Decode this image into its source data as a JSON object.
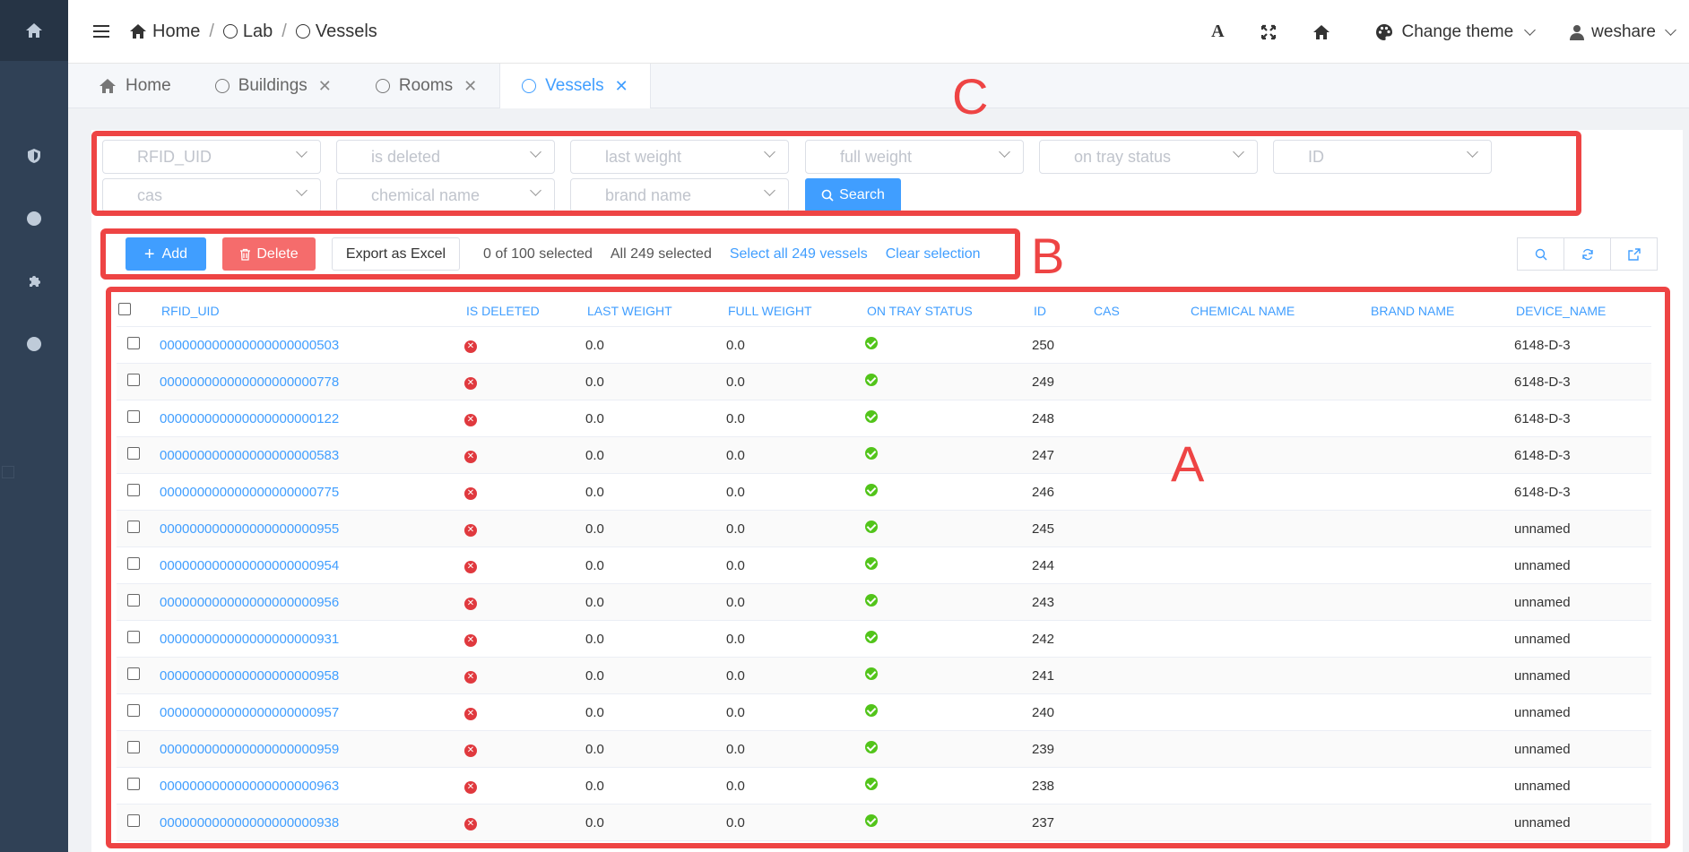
{
  "header": {
    "breadcrumbs": [
      "Home",
      "Lab",
      "Vessels"
    ],
    "font_icon": "A",
    "theme_label": "Change theme",
    "user_name": "weshare"
  },
  "tabs": [
    {
      "label": "Home",
      "icon": "home-icon",
      "active": false,
      "closable": false
    },
    {
      "label": "Buildings",
      "icon": "circle-icon",
      "active": false,
      "closable": true
    },
    {
      "label": "Rooms",
      "icon": "circle-icon",
      "active": false,
      "closable": true
    },
    {
      "label": "Vessels",
      "icon": "circle-icon",
      "active": true,
      "closable": true
    }
  ],
  "filters": {
    "rfid_uid": "RFID_UID",
    "is_deleted": "is deleted",
    "last_weight": "last weight",
    "full_weight": "full weight",
    "on_tray_status": "on tray status",
    "id": "ID",
    "cas": "cas",
    "chemical_name": "chemical name",
    "brand_name": "brand name",
    "search_label": "Search"
  },
  "toolbar": {
    "add_label": "Add",
    "delete_label": "Delete",
    "export_label": "Export as Excel",
    "selected_text": "0 of 100 selected",
    "all_selected_text": "All 249 selected",
    "select_all_link": "Select all 249 vessels",
    "clear_link": "Clear selection"
  },
  "table": {
    "columns": [
      "RFID_UID",
      "IS DELETED",
      "LAST WEIGHT",
      "FULL WEIGHT",
      "ON TRAY STATUS",
      "ID",
      "CAS",
      "CHEMICAL NAME",
      "BRAND NAME",
      "DEVICE_NAME"
    ],
    "rows": [
      {
        "uid": "000000000000000000000503",
        "last": "0.0",
        "full": "0.0",
        "id": "250",
        "cas": "",
        "chem": "",
        "brand": "",
        "device": "6148-D-3"
      },
      {
        "uid": "000000000000000000000778",
        "last": "0.0",
        "full": "0.0",
        "id": "249",
        "cas": "",
        "chem": "",
        "brand": "",
        "device": "6148-D-3"
      },
      {
        "uid": "000000000000000000000122",
        "last": "0.0",
        "full": "0.0",
        "id": "248",
        "cas": "",
        "chem": "",
        "brand": "",
        "device": "6148-D-3"
      },
      {
        "uid": "000000000000000000000583",
        "last": "0.0",
        "full": "0.0",
        "id": "247",
        "cas": "",
        "chem": "",
        "brand": "",
        "device": "6148-D-3"
      },
      {
        "uid": "000000000000000000000775",
        "last": "0.0",
        "full": "0.0",
        "id": "246",
        "cas": "",
        "chem": "",
        "brand": "",
        "device": "6148-D-3"
      },
      {
        "uid": "000000000000000000000955",
        "last": "0.0",
        "full": "0.0",
        "id": "245",
        "cas": "",
        "chem": "",
        "brand": "",
        "device": "unnamed"
      },
      {
        "uid": "000000000000000000000954",
        "last": "0.0",
        "full": "0.0",
        "id": "244",
        "cas": "",
        "chem": "",
        "brand": "",
        "device": "unnamed"
      },
      {
        "uid": "000000000000000000000956",
        "last": "0.0",
        "full": "0.0",
        "id": "243",
        "cas": "",
        "chem": "",
        "brand": "",
        "device": "unnamed"
      },
      {
        "uid": "000000000000000000000931",
        "last": "0.0",
        "full": "0.0",
        "id": "242",
        "cas": "",
        "chem": "",
        "brand": "",
        "device": "unnamed"
      },
      {
        "uid": "000000000000000000000958",
        "last": "0.0",
        "full": "0.0",
        "id": "241",
        "cas": "",
        "chem": "",
        "brand": "",
        "device": "unnamed"
      },
      {
        "uid": "000000000000000000000957",
        "last": "0.0",
        "full": "0.0",
        "id": "240",
        "cas": "",
        "chem": "",
        "brand": "",
        "device": "unnamed"
      },
      {
        "uid": "000000000000000000000959",
        "last": "0.0",
        "full": "0.0",
        "id": "239",
        "cas": "",
        "chem": "",
        "brand": "",
        "device": "unnamed"
      },
      {
        "uid": "000000000000000000000963",
        "last": "0.0",
        "full": "0.0",
        "id": "238",
        "cas": "",
        "chem": "",
        "brand": "",
        "device": "unnamed"
      },
      {
        "uid": "000000000000000000000938",
        "last": "0.0",
        "full": "0.0",
        "id": "237",
        "cas": "",
        "chem": "",
        "brand": "",
        "device": "unnamed"
      }
    ]
  },
  "annotations": {
    "a": "A",
    "b": "B",
    "c": "C"
  },
  "colors": {
    "accent": "#409eff",
    "danger": "#f56c6c",
    "sidebar": "#304156",
    "annotation": "#ee4444",
    "success": "#52c41a"
  }
}
